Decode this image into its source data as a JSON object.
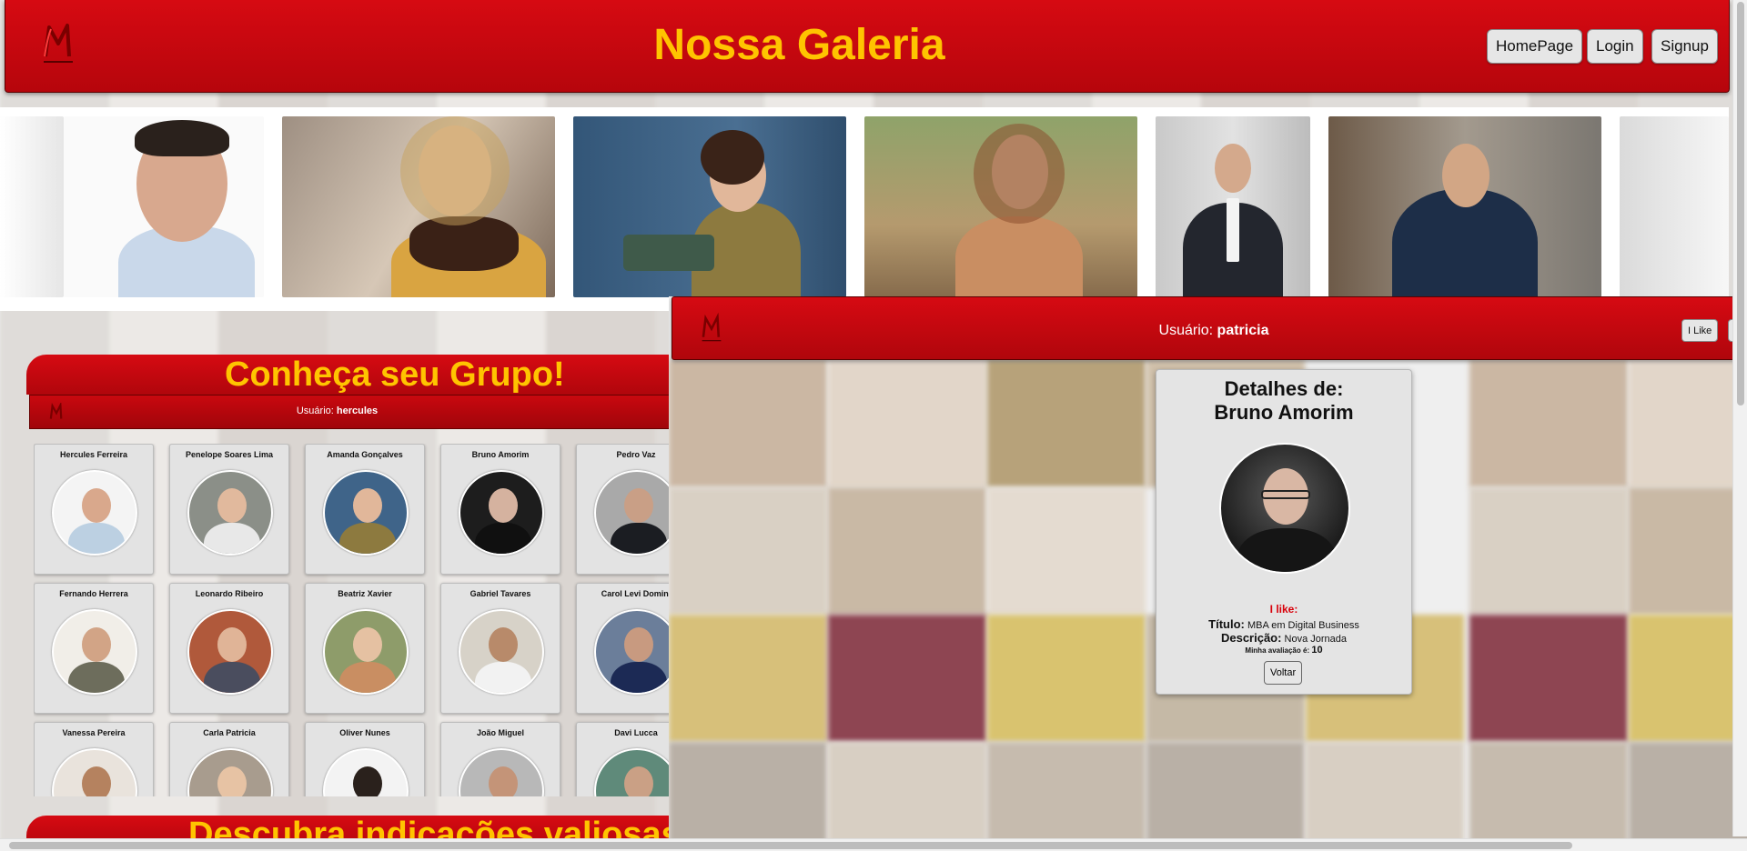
{
  "header": {
    "title": "Nossa Galeria",
    "nav": [
      {
        "label": "HomePage"
      },
      {
        "label": "Login"
      },
      {
        "label": "Signup"
      }
    ]
  },
  "gallery_strip": {
    "photos": [
      {
        "name": "man-smiling-glasses"
      },
      {
        "name": "woman-on-phone-scarf"
      },
      {
        "name": "woman-reading-book"
      },
      {
        "name": "woman-with-coffee"
      },
      {
        "name": "man-in-suit"
      },
      {
        "name": "man-with-phone-street"
      },
      {
        "name": "street-scene"
      }
    ]
  },
  "group_section": {
    "title": "Conheça seu Grupo!",
    "user_label": "Usuário:",
    "user_name": "hercules",
    "members": [
      {
        "name": "Hercules Ferreira"
      },
      {
        "name": "Penelope Soares Lima"
      },
      {
        "name": "Amanda Gonçalves"
      },
      {
        "name": "Bruno Amorim"
      },
      {
        "name": "Pedro Vaz"
      },
      {
        "name": "Fernando Herrera"
      },
      {
        "name": "Leonardo Ribeiro"
      },
      {
        "name": "Beatriz Xavier"
      },
      {
        "name": "Gabriel Tavares"
      },
      {
        "name": "Carol Levi Domini"
      },
      {
        "name": "Vanessa Pereira"
      },
      {
        "name": "Carla Patricia"
      },
      {
        "name": "Oliver Nunes"
      },
      {
        "name": "João Miguel"
      },
      {
        "name": "Davi Lucca"
      }
    ]
  },
  "discover_section": {
    "title": "Descubra indicações valiosas"
  },
  "detail_panel": {
    "user_label": "Usuário:",
    "user_name": "patricia",
    "like_button": "I Like",
    "second_button": "I",
    "heading_line1": "Detalhes de:",
    "heading_line2": "Bruno Amorim",
    "i_like_label": "I like:",
    "title_label": "Título:",
    "title_value": "MBA em Digital Business",
    "description_label": "Descrição:",
    "description_value": "Nova Jornada",
    "rating_label": "Minha avaliação é:",
    "rating_value": "10",
    "back_button": "Voltar"
  },
  "colors": {
    "brand_red": "#d60a12",
    "title_yellow": "#ffc400",
    "highlight_red": "#d8000a"
  },
  "icons": {
    "logo": "m-logo-icon"
  }
}
